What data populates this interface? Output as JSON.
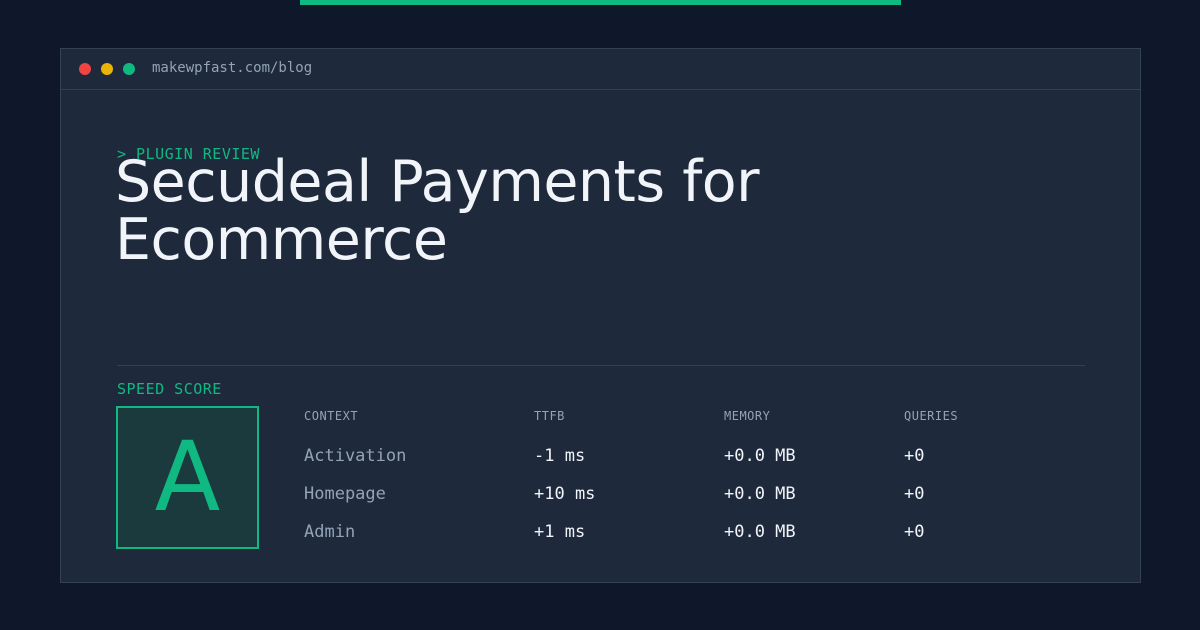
{
  "browser": {
    "url": "makewpfast.com/blog"
  },
  "header": {
    "eyebrow": "> PLUGIN REVIEW",
    "title": "Secudeal Payments for Ecommerce"
  },
  "score": {
    "label": "SPEED SCORE",
    "grade": "A"
  },
  "table": {
    "columns": [
      "CONTEXT",
      "TTFB",
      "MEMORY",
      "QUERIES"
    ],
    "rows": [
      {
        "context": "Activation",
        "ttfb": "-1 ms",
        "memory": "+0.0 MB",
        "queries": "+0"
      },
      {
        "context": "Homepage",
        "ttfb": "+10 ms",
        "memory": "+0.0 MB",
        "queries": "+0"
      },
      {
        "context": "Admin",
        "ttfb": "+1 ms",
        "memory": "+0.0 MB",
        "queries": "+0"
      }
    ]
  },
  "colors": {
    "accent": "#10b981",
    "background": "#0f172a",
    "panel": "#1e293b",
    "close_dot": "#ef4444",
    "minimize_dot": "#eab308",
    "maximize_dot": "#10b981"
  }
}
